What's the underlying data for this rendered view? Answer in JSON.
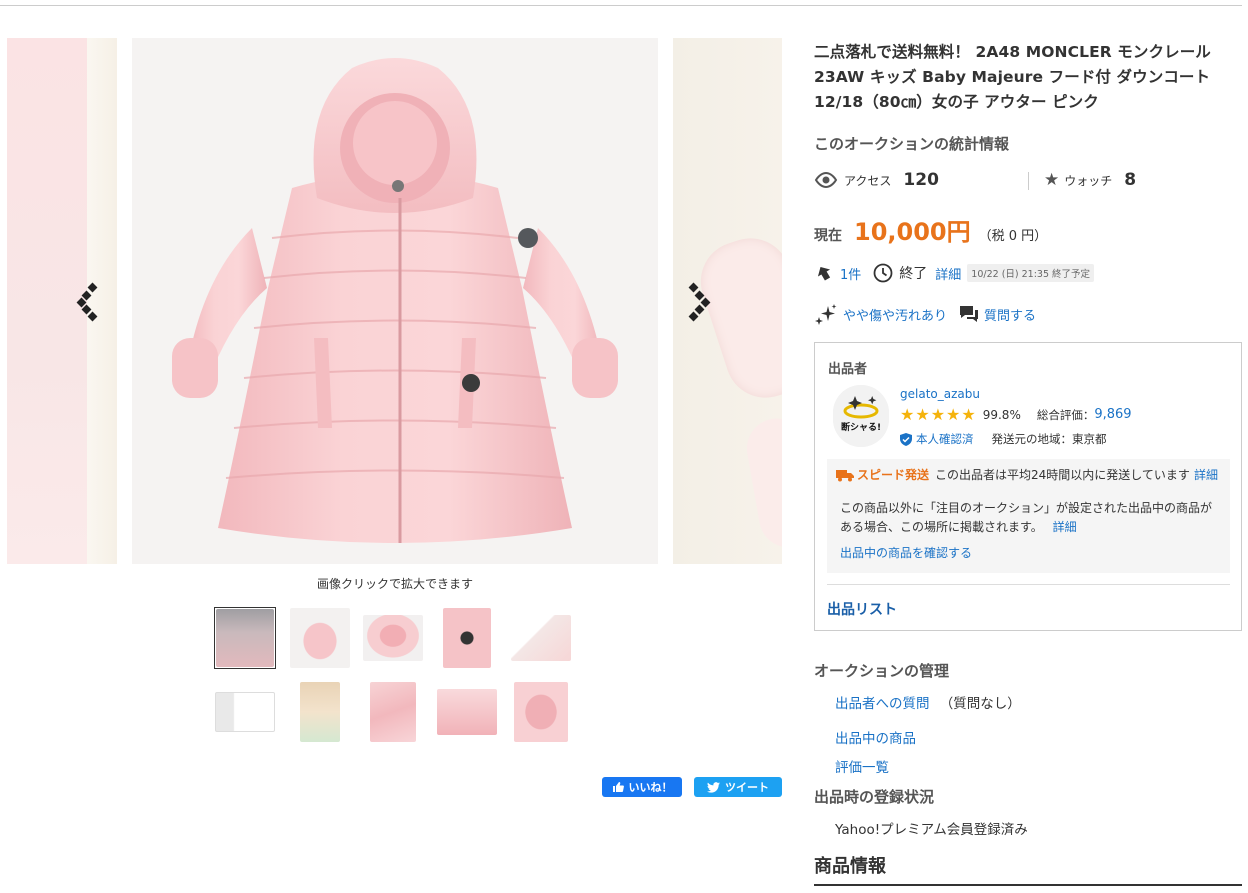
{
  "gallery": {
    "zoom_caption": "画像クリックで拡大できます",
    "thumbnail_count": 10,
    "active_thumbnail": 1
  },
  "social": {
    "like_label": "いいね！",
    "tweet_label": "ツイート"
  },
  "item": {
    "title": "二点落札で送料無料！ 2A48 MONCLER モンクレール 23AW キッズ Baby Majeure フード付 ダウンコート 12/18（80㎝）女の子 アウター ピンク"
  },
  "stats": {
    "heading": "このオークションの統計情報",
    "access_label": "アクセス",
    "access_count": "120",
    "watch_label": "ウォッチ",
    "watch_count": "8"
  },
  "price": {
    "label": "現在",
    "value": "10,000円",
    "tax": "（税 0 円）"
  },
  "bid": {
    "count": "1件",
    "end_label": "終了",
    "detail_link": "詳細",
    "end_time": "10/22 (日) 21:35 終了予定"
  },
  "condition": {
    "label": "やや傷や汚れあり",
    "question_link": "質問する"
  },
  "seller": {
    "heading": "出品者",
    "avatar_text": "断シャる!",
    "name": "gelato_azabu",
    "rating_percent": "99.8%",
    "total_label": "総合評価：",
    "total_value": "9,869",
    "verified_label": "本人確認済",
    "ship_from": "発送元の地域：東京都",
    "speed_badge": "スピード発送",
    "speed_text": "この出品者は平均24時間以内に発送しています",
    "speed_detail": "詳細",
    "notice_text": "この商品以外に「注目のオークション」が設定された出品中の商品がある場合、この場所に掲載されます。",
    "notice_detail": "詳細",
    "check_link": "出品中の商品を確認する",
    "list_link": "出品リスト"
  },
  "management": {
    "heading": "オークションの管理",
    "question_link": "出品者への質問",
    "question_status": "（質問なし）",
    "listing_link": "出品中の商品",
    "reviews_link": "評価一覧"
  },
  "registration": {
    "heading": "出品時の登録状況",
    "value": "Yahoo!プレミアム会員登録済み"
  },
  "product_info": {
    "heading": "商品情報"
  },
  "colors": {
    "price": "#e8731b",
    "link": "#1a72c6",
    "coat_pink": "#f8c9cc"
  }
}
